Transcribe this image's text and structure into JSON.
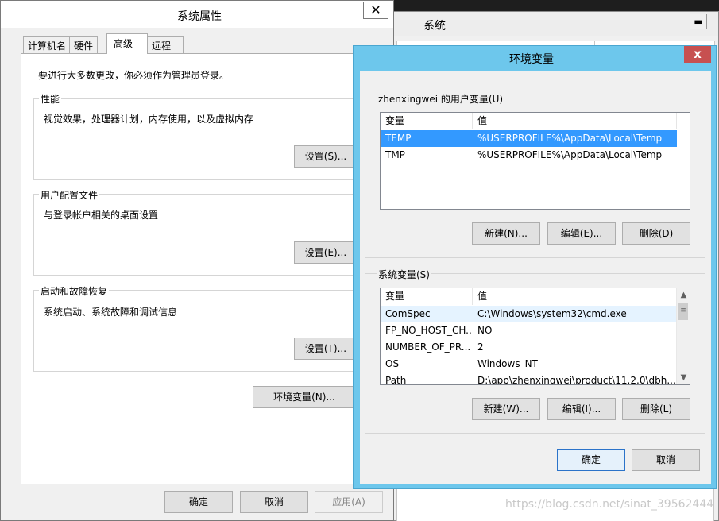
{
  "system_window": {
    "title": "系统",
    "minimize_glyph": "▬",
    "maximize_glyph": "▯"
  },
  "props": {
    "title": "系统属性",
    "close_glyph": "✕",
    "tabs": [
      "计算机名",
      "硬件",
      "高级",
      "远程"
    ],
    "active_tab": "高级",
    "admin_note": "要进行大多数更改，你必须作为管理员登录。",
    "performance": {
      "label": "性能",
      "desc": "视觉效果，处理器计划，内存使用，以及虚拟内存",
      "button": "设置(S)..."
    },
    "profile": {
      "label": "用户配置文件",
      "desc": "与登录帐户相关的桌面设置",
      "button": "设置(E)..."
    },
    "startup": {
      "label": "启动和故障恢复",
      "desc": "系统启动、系统故障和调试信息",
      "button": "设置(T)..."
    },
    "env_button": "环境变量(N)...",
    "ok": "确定",
    "cancel": "取消",
    "apply": "应用(A)"
  },
  "env": {
    "title": "环境变量",
    "close_glyph": "x",
    "user_section": "zhenxingwei 的用户变量(U)",
    "columns": [
      "变量",
      "值"
    ],
    "user_vars": [
      {
        "name": "TEMP",
        "value": "%USERPROFILE%\\AppData\\Local\\Temp",
        "selected": true
      },
      {
        "name": "TMP",
        "value": "%USERPROFILE%\\AppData\\Local\\Temp",
        "selected": false
      }
    ],
    "user_buttons": {
      "new": "新建(N)...",
      "edit": "编辑(E)...",
      "delete": "删除(D)"
    },
    "system_section": "系统变量(S)",
    "system_vars": [
      {
        "name": "ComSpec",
        "value": "C:\\Windows\\system32\\cmd.exe"
      },
      {
        "name": "FP_NO_HOST_CH...",
        "value": "NO"
      },
      {
        "name": "NUMBER_OF_PR...",
        "value": "2"
      },
      {
        "name": "OS",
        "value": "Windows_NT"
      },
      {
        "name": "Path",
        "value": "D:\\app\\zhenxingwei\\product\\11.2.0\\dbh..."
      }
    ],
    "system_buttons": {
      "new": "新建(W)...",
      "edit": "编辑(I)...",
      "delete": "删除(L)"
    },
    "ok": "确定",
    "cancel": "取消"
  },
  "watermark": "https://blog.csdn.net/sinat_39562444"
}
